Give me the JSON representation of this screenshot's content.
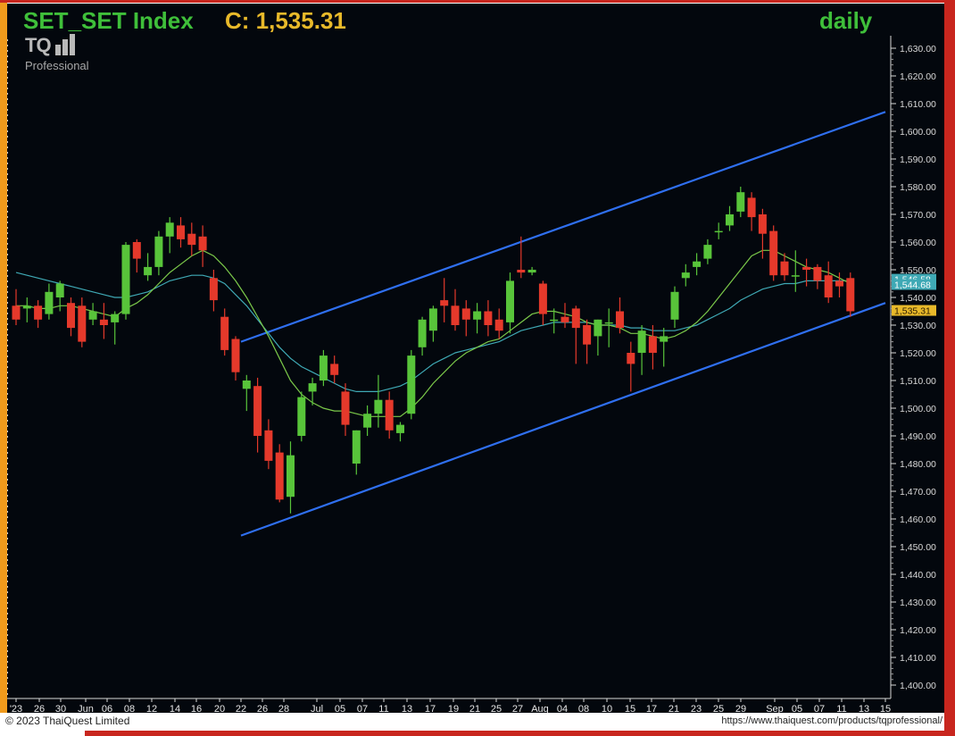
{
  "header": {
    "symbol_title": "SET_SET Index",
    "close_label": "C: 1,535.31",
    "period": "daily",
    "logo_text": "TQ",
    "logo_sub": "Professional"
  },
  "footer": {
    "copyright": "© 2023 ThaiQuest Limited",
    "url": "https://www.thaiquest.com/products/tqprofessional/"
  },
  "colors": {
    "background": "#03070d",
    "up": "#58c43a",
    "down": "#e5392b",
    "ma_short": "#7bc94a",
    "ma_long": "#3fa9b5",
    "channel": "#2f6ff0",
    "title_green": "#3fbf3a",
    "title_gold": "#e8b92a"
  },
  "chart_data": {
    "type": "candlestick",
    "ylim": [
      1395,
      1635
    ],
    "y_ticks": [
      "1,630.00",
      "1,620.00",
      "1,610.00",
      "1,600.00",
      "1,590.00",
      "1,580.00",
      "1,570.00",
      "1,560.00",
      "1,550.00",
      "1,540.00",
      "1,530.00",
      "1,520.00",
      "1,510.00",
      "1,500.00",
      "1,490.00",
      "1,480.00",
      "1,470.00",
      "1,460.00",
      "1,450.00",
      "1,440.00",
      "1,430.00",
      "1,420.00",
      "1,410.00",
      "1,400.00"
    ],
    "x_ticks": [
      "'23",
      "26",
      "30",
      "Jun",
      "06",
      "08",
      "12",
      "14",
      "16",
      "20",
      "22",
      "26",
      "28",
      "Jul",
      "05",
      "07",
      "11",
      "13",
      "17",
      "19",
      "21",
      "25",
      "27",
      "Aug",
      "04",
      "08",
      "10",
      "15",
      "17",
      "21",
      "23",
      "25",
      "29",
      "Sep",
      "05",
      "07",
      "11",
      "13",
      "15"
    ],
    "price_labels": [
      {
        "text": "1,546.58",
        "value": 1546.58,
        "color": "#3fa9b5"
      },
      {
        "text": "1,544.68",
        "value": 1544.68,
        "color": "#ffffff"
      },
      {
        "text": "1,535.31",
        "value": 1535.31,
        "color": "#e8b92a"
      }
    ],
    "candles": [
      [
        1537,
        1543,
        1530,
        1532
      ],
      [
        1536,
        1540,
        1531,
        1537
      ],
      [
        1537,
        1539,
        1529,
        1532
      ],
      [
        1534,
        1545,
        1532,
        1542
      ],
      [
        1540,
        1546,
        1535,
        1545
      ],
      [
        1538,
        1540,
        1526,
        1529
      ],
      [
        1537,
        1540,
        1522,
        1524
      ],
      [
        1532,
        1538,
        1530,
        1535
      ],
      [
        1532,
        1538,
        1525,
        1530
      ],
      [
        1531,
        1535,
        1523,
        1534
      ],
      [
        1534,
        1560,
        1532,
        1559
      ],
      [
        1560,
        1561,
        1549,
        1554
      ],
      [
        1548,
        1556,
        1546,
        1551
      ],
      [
        1551,
        1564,
        1548,
        1562
      ],
      [
        1562,
        1569,
        1556,
        1567
      ],
      [
        1566,
        1569,
        1558,
        1561
      ],
      [
        1563,
        1567,
        1555,
        1559
      ],
      [
        1562,
        1566,
        1551,
        1557
      ],
      [
        1547,
        1550,
        1535,
        1539
      ],
      [
        1533,
        1536,
        1519,
        1521
      ],
      [
        1525,
        1526,
        1510,
        1513
      ],
      [
        1507,
        1512,
        1499,
        1510
      ],
      [
        1508,
        1511,
        1484,
        1490
      ],
      [
        1492,
        1496,
        1478,
        1481
      ],
      [
        1484,
        1487,
        1466,
        1467
      ],
      [
        1468,
        1488,
        1462,
        1483
      ],
      [
        1490,
        1506,
        1488,
        1504
      ],
      [
        1506,
        1511,
        1501,
        1509
      ],
      [
        1510,
        1521,
        1508,
        1519
      ],
      [
        1516,
        1519,
        1509,
        1512
      ],
      [
        1506,
        1509,
        1490,
        1494
      ],
      [
        1480,
        1492,
        1476,
        1492
      ],
      [
        1493,
        1501,
        1490,
        1498
      ],
      [
        1498,
        1512,
        1493,
        1503
      ],
      [
        1503,
        1506,
        1489,
        1492
      ],
      [
        1491,
        1495,
        1488,
        1494
      ],
      [
        1498,
        1521,
        1496,
        1519
      ],
      [
        1522,
        1533,
        1519,
        1532
      ],
      [
        1528,
        1537,
        1524,
        1536
      ],
      [
        1539,
        1547,
        1531,
        1537
      ],
      [
        1537,
        1543,
        1528,
        1530
      ],
      [
        1536,
        1539,
        1526,
        1532
      ],
      [
        1532,
        1538,
        1527,
        1535
      ],
      [
        1535,
        1539,
        1526,
        1530
      ],
      [
        1532,
        1536,
        1525,
        1528
      ],
      [
        1531,
        1549,
        1527,
        1546
      ],
      [
        1550,
        1562,
        1547,
        1549
      ],
      [
        1549,
        1551,
        1548,
        1550
      ],
      [
        1545,
        1546,
        1530,
        1534
      ],
      [
        1532,
        1536,
        1527,
        1532
      ],
      [
        1533,
        1538,
        1529,
        1531
      ],
      [
        1536,
        1537,
        1516,
        1529
      ],
      [
        1530,
        1532,
        1516,
        1523
      ],
      [
        1526,
        1532,
        1519,
        1532
      ],
      [
        1531,
        1536,
        1522,
        1531
      ],
      [
        1535,
        1540,
        1527,
        1529
      ],
      [
        1520,
        1524,
        1506,
        1516
      ],
      [
        1520,
        1530,
        1512,
        1528
      ],
      [
        1526,
        1530,
        1514,
        1520
      ],
      [
        1524,
        1529,
        1515,
        1526
      ],
      [
        1532,
        1544,
        1529,
        1542
      ],
      [
        1547,
        1552,
        1544,
        1549
      ],
      [
        1551,
        1556,
        1548,
        1553
      ],
      [
        1554,
        1561,
        1552,
        1559
      ],
      [
        1564,
        1567,
        1561,
        1564
      ],
      [
        1566,
        1573,
        1564,
        1570
      ],
      [
        1571,
        1580,
        1569,
        1578
      ],
      [
        1576,
        1578,
        1564,
        1569
      ],
      [
        1570,
        1572,
        1554,
        1563
      ],
      [
        1564,
        1566,
        1546,
        1548
      ],
      [
        1553,
        1556,
        1546,
        1548
      ],
      [
        1548,
        1557,
        1542,
        1548
      ],
      [
        1551,
        1554,
        1544,
        1550
      ],
      [
        1551,
        1552,
        1543,
        1546
      ],
      [
        1548,
        1553,
        1538,
        1540
      ],
      [
        1546,
        1549,
        1540,
        1544
      ],
      [
        1547,
        1549,
        1533,
        1535
      ]
    ],
    "ma_short": [
      1537,
      1537,
      1536,
      1536,
      1537,
      1537,
      1536,
      1535,
      1534,
      1533,
      1536,
      1538,
      1541,
      1545,
      1549,
      1552,
      1555,
      1557,
      1555,
      1551,
      1546,
      1540,
      1533,
      1526,
      1518,
      1510,
      1505,
      1502,
      1500,
      1499,
      1499,
      1498,
      1497,
      1497,
      1497,
      1497,
      1500,
      1504,
      1509,
      1513,
      1517,
      1520,
      1522,
      1524,
      1525,
      1528,
      1531,
      1534,
      1535,
      1535,
      1534,
      1533,
      1531,
      1530,
      1530,
      1529,
      1527,
      1527,
      1526,
      1525,
      1526,
      1528,
      1531,
      1535,
      1540,
      1545,
      1550,
      1555,
      1557,
      1557,
      1555,
      1553,
      1551,
      1550,
      1549,
      1547,
      1545
    ],
    "ma_long": [
      1549,
      1548,
      1547,
      1546,
      1545,
      1544,
      1543,
      1542,
      1541,
      1540,
      1540,
      1541,
      1542,
      1544,
      1546,
      1547,
      1548,
      1548,
      1547,
      1545,
      1541,
      1537,
      1532,
      1527,
      1522,
      1518,
      1515,
      1513,
      1511,
      1509,
      1507,
      1506,
      1506,
      1506,
      1507,
      1508,
      1510,
      1513,
      1516,
      1518,
      1520,
      1521,
      1522,
      1523,
      1524,
      1526,
      1528,
      1529,
      1530,
      1531,
      1531,
      1531,
      1531,
      1530,
      1530,
      1530,
      1529,
      1529,
      1528,
      1528,
      1528,
      1529,
      1530,
      1532,
      1534,
      1536,
      1539,
      1541,
      1543,
      1544,
      1545,
      1545,
      1546,
      1546,
      1546,
      1546,
      1546
    ],
    "channel_lines": [
      {
        "from": [
          0,
          1524
        ],
        "to": [
          78,
          1607
        ]
      },
      {
        "from": [
          0,
          1454
        ],
        "to": [
          78,
          1538
        ]
      }
    ]
  }
}
